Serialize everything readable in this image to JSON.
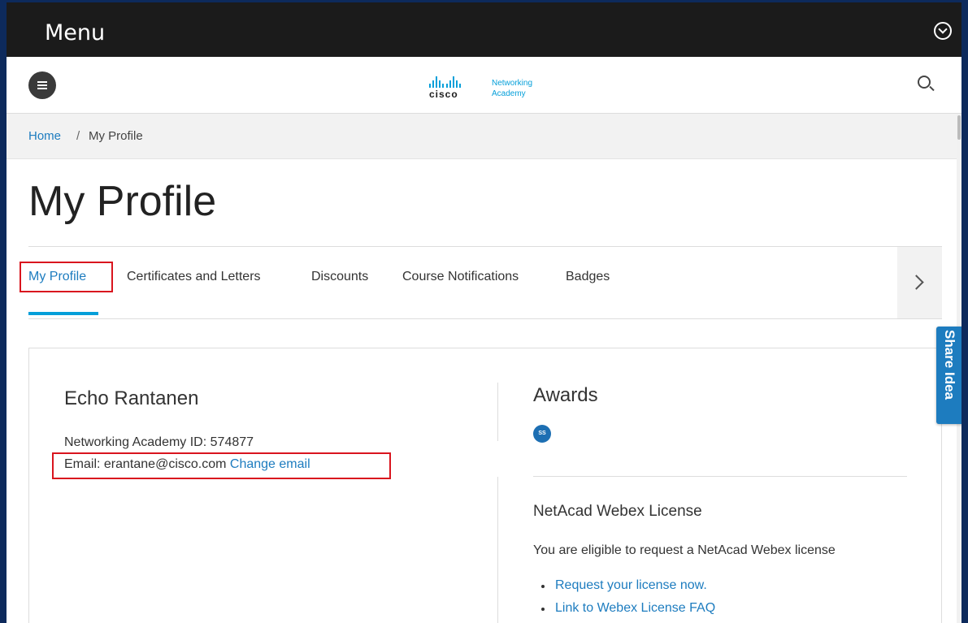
{
  "menubar": {
    "title": "Menu",
    "toggle_icon": "chevron-circle-down-icon"
  },
  "header": {
    "menu_icon": "hamburger-menu-icon",
    "logo": {
      "brand": "cisco",
      "line1": "Networking",
      "line2": "Academy"
    },
    "search_icon": "search-icon"
  },
  "breadcrumb": {
    "home": "Home",
    "separator": "/",
    "current": "My Profile"
  },
  "page": {
    "title": "My Profile"
  },
  "tabs": [
    {
      "label": "My Profile",
      "active": true
    },
    {
      "label": "Certificates and Letters"
    },
    {
      "label": "Discounts"
    },
    {
      "label": "Course Notifications"
    },
    {
      "label": "Badges"
    }
  ],
  "profile": {
    "name": "Echo Rantanen",
    "academy_id_label": "Networking Academy ID:",
    "academy_id": "574877",
    "email_label": "Email:",
    "email": "erantane@cisco.com",
    "change_email": "Change email"
  },
  "awards": {
    "title": "Awards",
    "badge_text": "SS"
  },
  "webex": {
    "title": "NetAcad Webex License",
    "eligible_text": "You are eligible to request a NetAcad Webex license",
    "links": [
      "Request your license now.",
      "Link to Webex License FAQ"
    ]
  },
  "share_tab": {
    "label": "Share Idea"
  },
  "colors": {
    "accent": "#049fd9",
    "link": "#1d7cbf",
    "highlight": "#d9151e",
    "menubar": "#1b1b1b"
  }
}
